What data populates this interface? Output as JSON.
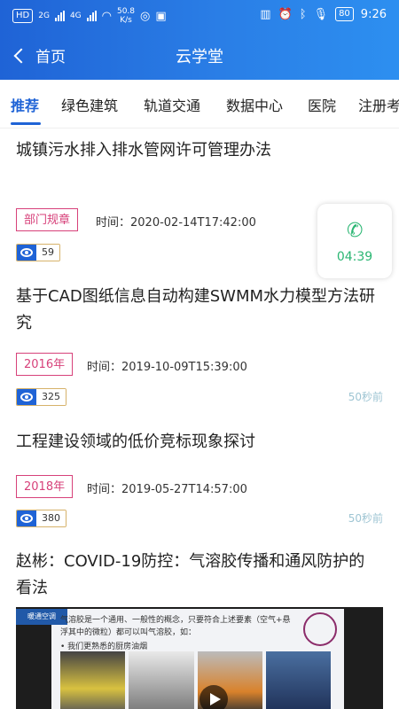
{
  "status": {
    "left_badge": "HD",
    "net1": "2G",
    "net2": "4G",
    "speed": "50.8",
    "speed_unit": "K/s",
    "battery": "80",
    "time": "9:26"
  },
  "nav": {
    "back_label": "首页",
    "title": "云学堂"
  },
  "tabs": [
    "推荐",
    "绿色建筑",
    "轨道交通",
    "数据中心",
    "医院",
    "注册考"
  ],
  "articles": [
    {
      "title": "城镇污水排入排水管网许可管理办法",
      "tag": "部门规章",
      "time": "时间：2020-02-14T17:42:00",
      "views": "59",
      "ago": ""
    },
    {
      "title": "基于CAD图纸信息自动构建SWMM水力模型方法研究",
      "tag": "2016年",
      "time": "时间：2019-10-09T15:39:00",
      "views": "325",
      "ago": "50秒前"
    },
    {
      "title": "工程建设领域的低价竞标现象探讨",
      "tag": "2018年",
      "time": "时间：2019-05-27T14:57:00",
      "views": "380",
      "ago": "50秒前"
    },
    {
      "title": "赵彬：COVID-19防控：气溶胶传播和通风防护的看法"
    }
  ],
  "call_widget": {
    "time": "04:39"
  },
  "video": {
    "brand": "暖通空调",
    "slide_text_1": "气溶胶是一个通用、一般性的概念，只要符合上述要素（空气+悬浮其中的微粒）都可以叫气溶胶，如：",
    "slide_text_2": "• 我们更熟悉的厨房油烟"
  },
  "colors": {
    "accent": "#1f63d6",
    "tag": "#d7417a",
    "call": "#2bb673"
  }
}
